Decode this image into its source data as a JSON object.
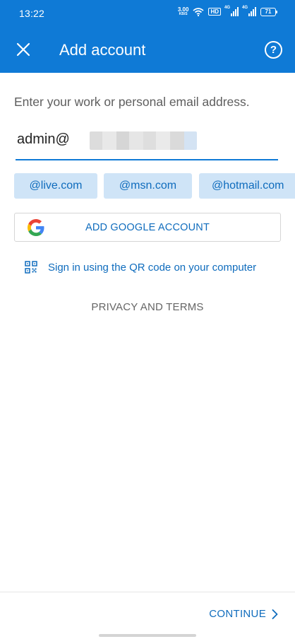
{
  "status_bar": {
    "time": "13:22",
    "net_speed_value": "3.00",
    "net_speed_unit": "KB/S",
    "hd_label": "HD",
    "signal_1_label": "4G",
    "signal_2_label": "4G",
    "battery_level": "71"
  },
  "app_bar": {
    "title": "Add account",
    "close_icon": "close-icon",
    "help_icon": "help-icon",
    "help_glyph": "?"
  },
  "form": {
    "prompt": "Enter your work or personal email address.",
    "email_value": "admin@",
    "domain_suggestions": [
      "@live.com",
      "@msn.com",
      "@hotmail.com"
    ]
  },
  "google_button": {
    "label": "ADD GOOGLE ACCOUNT",
    "icon": "google-icon"
  },
  "qr_signin": {
    "label": "Sign in using the QR code on your computer",
    "icon": "qr-code-icon"
  },
  "privacy": {
    "label": "PRIVACY AND TERMS"
  },
  "footer": {
    "continue_label": "CONTINUE",
    "icon": "chevron-right-icon"
  },
  "colors": {
    "accent": "#0f7ad6",
    "link": "#0f6cbd",
    "chip_bg": "#cfe4f7"
  }
}
